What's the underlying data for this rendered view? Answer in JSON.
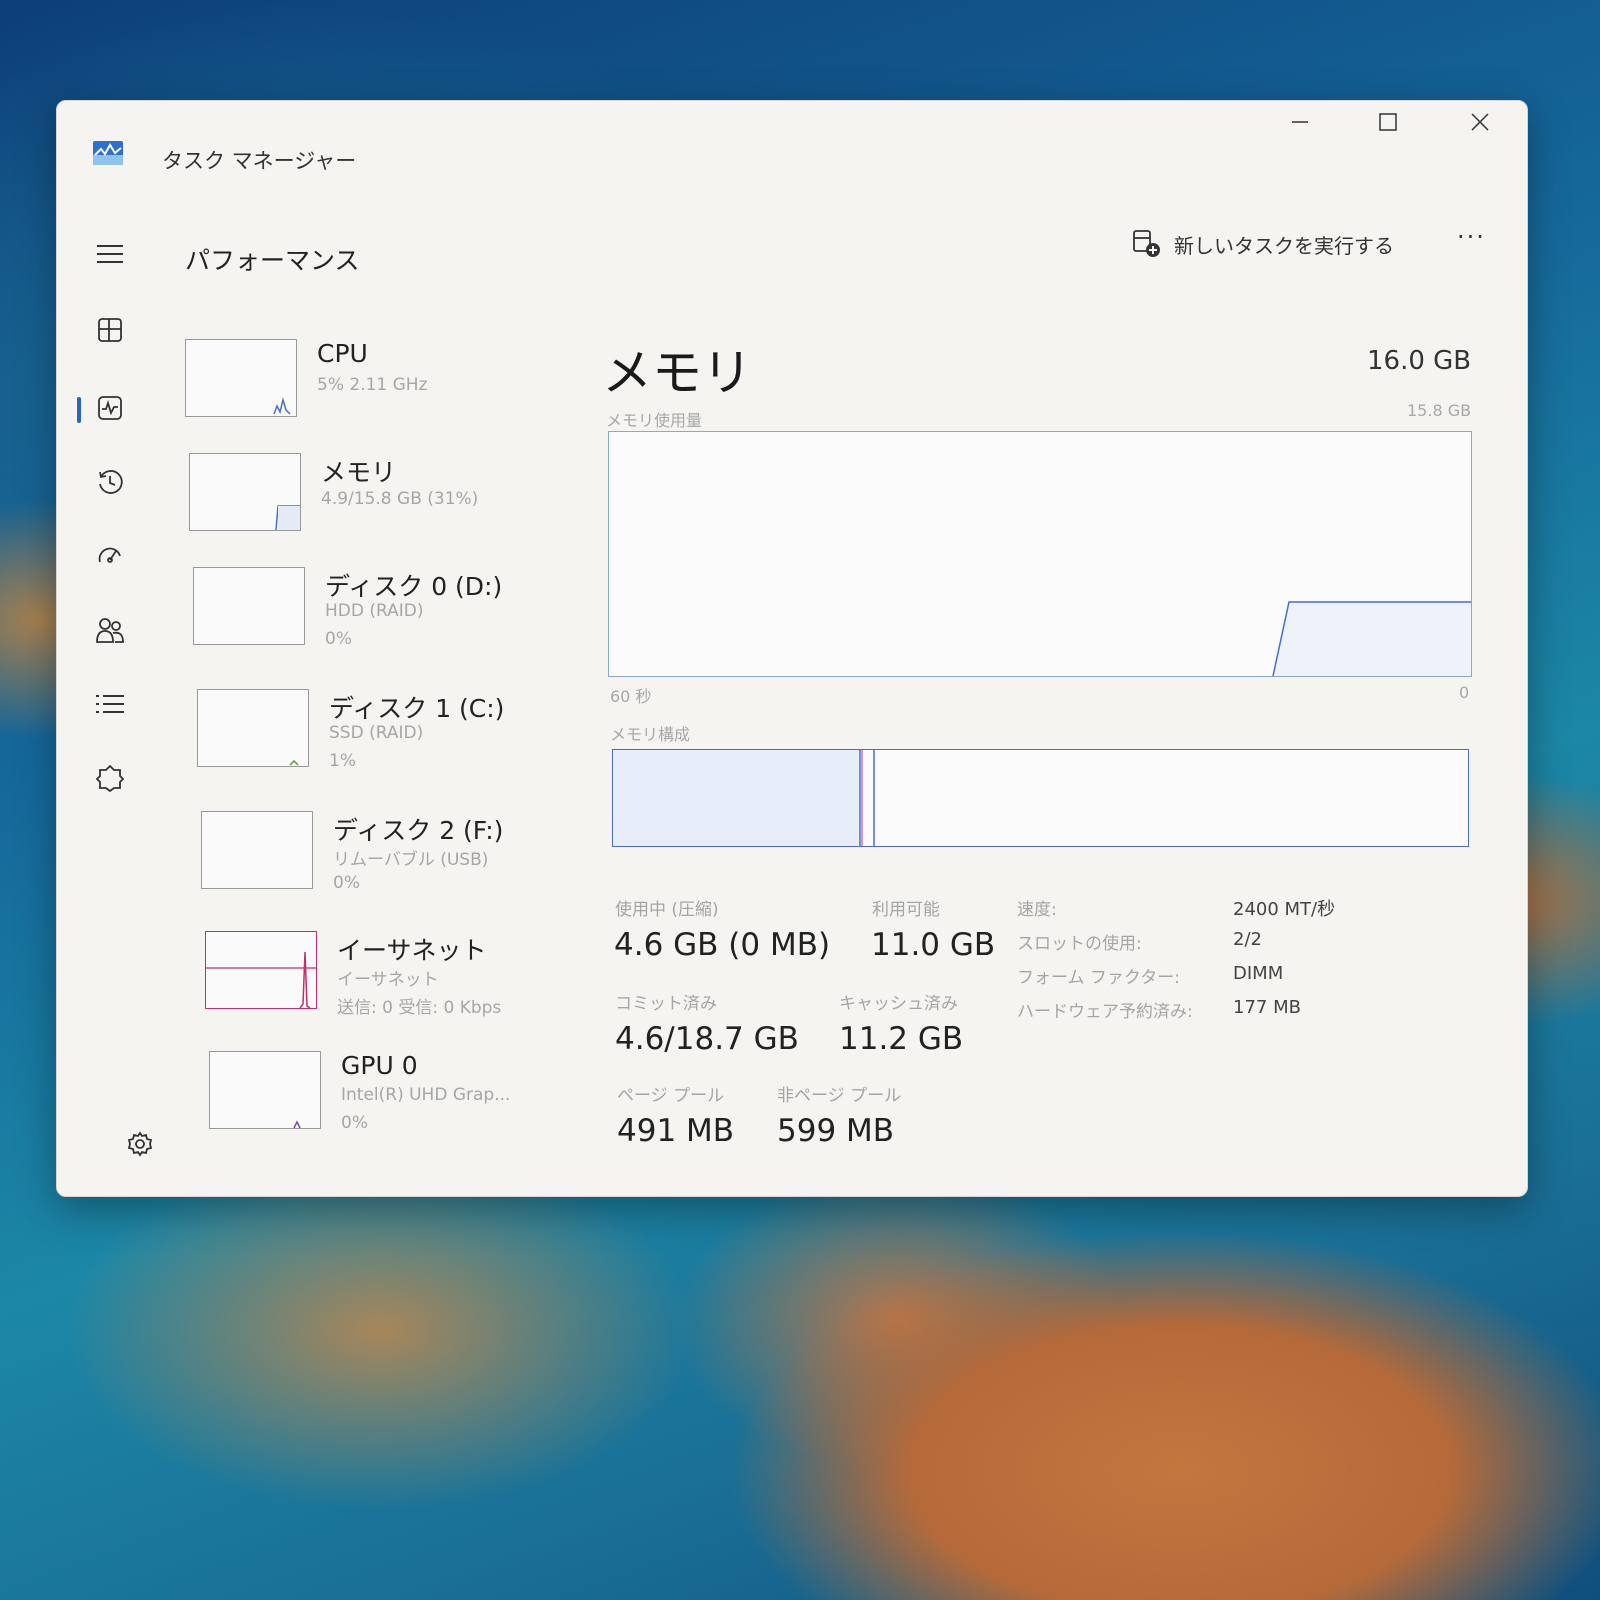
{
  "window": {
    "title": "タスク マネージャー"
  },
  "header": {
    "page_title": "パフォーマンス",
    "new_task_label": "新しいタスクを実行する",
    "more_label": "···"
  },
  "nav": {
    "items": [
      "menu-icon",
      "processes-icon",
      "performance-icon",
      "app-history-icon",
      "startup-apps-icon",
      "users-icon",
      "details-icon",
      "services-icon",
      "settings-icon"
    ],
    "active": "performance"
  },
  "devices": [
    {
      "name": "CPU",
      "line1": "5% 2.11 GHz",
      "line2": ""
    },
    {
      "name": "メモリ",
      "line1": "4.9/15.8 GB (31%)",
      "line2": ""
    },
    {
      "name": "ディスク 0 (D:)",
      "line1": "HDD (RAID)",
      "line2": "0%"
    },
    {
      "name": "ディスク 1 (C:)",
      "line1": "SSD (RAID)",
      "line2": "1%"
    },
    {
      "name": "ディスク 2 (F:)",
      "line1": "リムーバブル (USB)",
      "line2": "0%"
    },
    {
      "name": "イーサネット",
      "line1": "イーサネット",
      "line2": "送信: 0 受信: 0 Kbps"
    },
    {
      "name": "GPU 0",
      "line1": "Intel(R) UHD Grap...",
      "line2": "0%"
    }
  ],
  "memory": {
    "title": "メモリ",
    "total": "16.0 GB",
    "usage_graph_label": "メモリ使用量",
    "usage_graph_max": "15.8 GB",
    "time_left": "60 秒",
    "time_right": "0",
    "composition_label": "メモリ構成",
    "in_use_label": "使用中 (圧縮)",
    "in_use_value": "4.6 GB (0 MB)",
    "available_label": "利用可能",
    "available_value": "11.0 GB",
    "committed_label": "コミット済み",
    "committed_value": "4.6/18.7 GB",
    "cached_label": "キャッシュ済み",
    "cached_value": "11.2 GB",
    "paged_label": "ページ プール",
    "paged_value": "491 MB",
    "nonpaged_label": "非ページ プール",
    "nonpaged_value": "599 MB",
    "details": [
      {
        "key": "速度:",
        "value": "2400 MT/秒"
      },
      {
        "key": "スロットの使用:",
        "value": "2/2"
      },
      {
        "key": "フォーム ファクター:",
        "value": "DIMM"
      },
      {
        "key": "ハードウェア予約済み:",
        "value": "177 MB"
      }
    ]
  },
  "colors": {
    "memory_line": "#4a6fc0",
    "ethernet_line": "#c0306a",
    "accent": "#2a62c9"
  }
}
